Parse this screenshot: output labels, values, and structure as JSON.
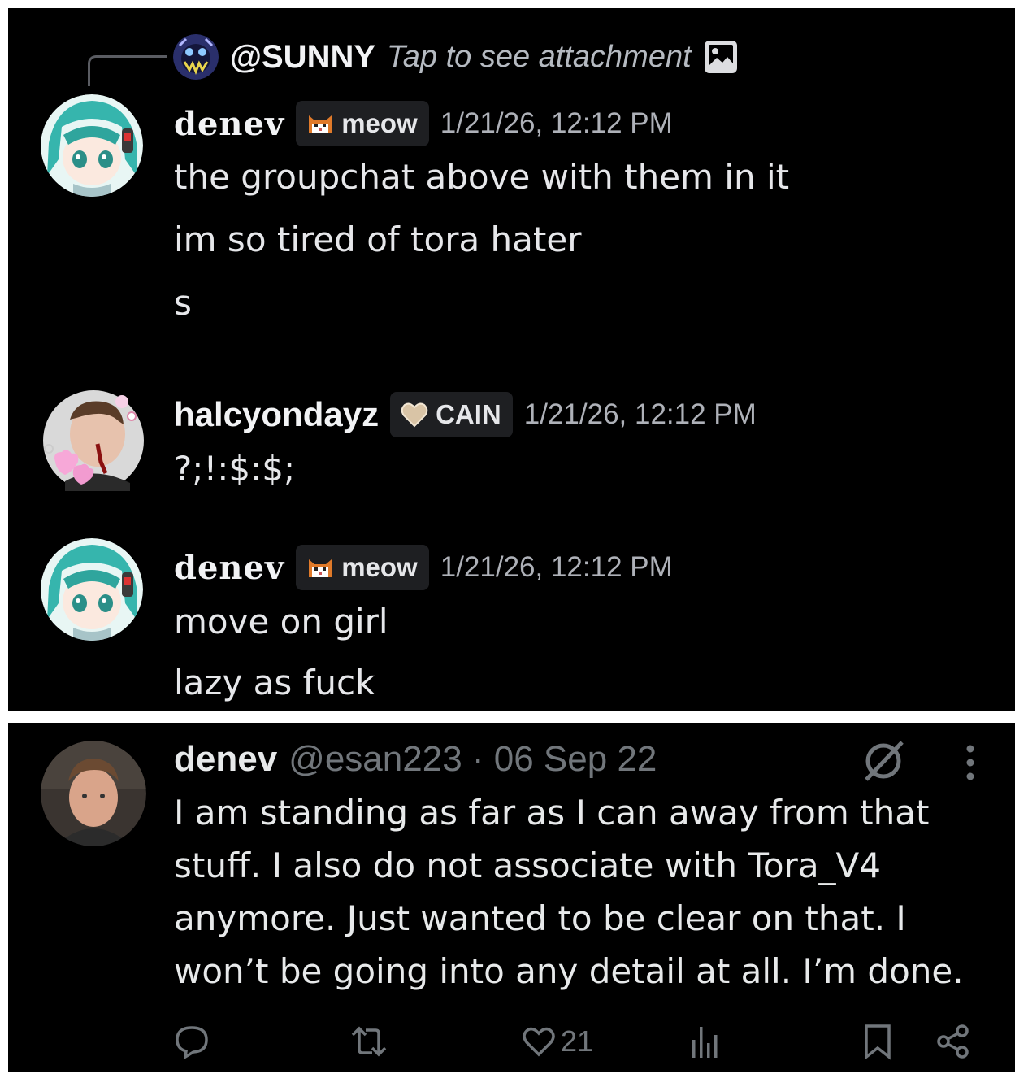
{
  "colors": {
    "panel_bg": "#000000",
    "page_bg": "#ffffff",
    "muted": "#71767b",
    "text": "#e7e9ea"
  },
  "chat": {
    "reply": {
      "name": "@SUNNY",
      "text": "Tap to see attachment",
      "icon": "image-icon"
    },
    "messages": [
      {
        "user": "denev",
        "tag": {
          "icon": "cat-icon",
          "label": "meow"
        },
        "timestamp": "1/21/26, 12:12 PM",
        "lines": [
          "the groupchat above with them in it",
          "im so tired of tora hater",
          "s"
        ]
      },
      {
        "user": "halcyondayz",
        "tag": {
          "icon": "heart-icon",
          "label": "CAIN"
        },
        "timestamp": "1/21/26, 12:12 PM",
        "lines": [
          "?;!:$:$;"
        ]
      },
      {
        "user": "denev",
        "tag": {
          "icon": "cat-icon",
          "label": "meow"
        },
        "timestamp": "1/21/26, 12:12 PM",
        "lines": [
          "move on girl",
          "lazy as fuck"
        ]
      }
    ]
  },
  "tweet": {
    "name": "denev",
    "handle": "@esan223 · 06 Sep 22",
    "body": "I am standing as far as I can away from that stuff. I also do not associate with Tora_V4 anymore. Just wanted to be clear on that. I won’t be going into any detail at all. I’m done.",
    "actions": {
      "reply_icon": "reply-icon",
      "retweet_icon": "retweet-icon",
      "like_icon": "heart-icon",
      "like_count": "21",
      "views_icon": "views-icon",
      "bookmark_icon": "bookmark-icon",
      "share_icon": "share-icon"
    }
  }
}
